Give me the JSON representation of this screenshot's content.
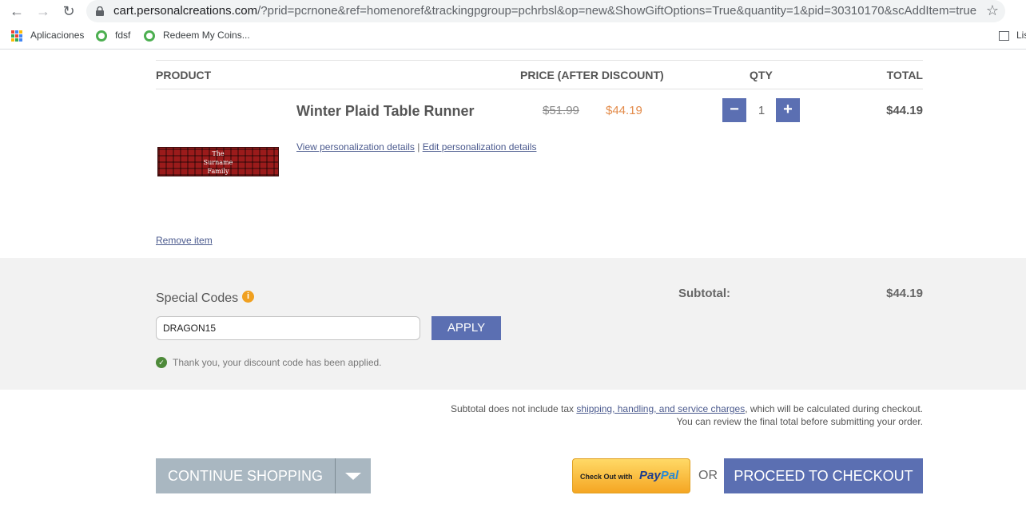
{
  "browser": {
    "url_host": "cart.personalcreations.com",
    "url_path": "/?prid=pcrnone&ref=homenoref&trackingpgroup=pchrbsl&op=new&ShowGiftOptions=True&quantity=1&pid=30310170&scAddItem=true&co...",
    "bookmarks": [
      "Aplicaciones",
      "fdsf",
      "Redeem My Coins..."
    ],
    "list_label": "Lis"
  },
  "cart": {
    "headers": {
      "product": "PRODUCT",
      "price": "PRICE (AFTER DISCOUNT)",
      "qty": "QTY",
      "total": "TOTAL"
    },
    "item": {
      "name": "Winter Plaid Table Runner",
      "price_original": "$51.99",
      "price_discounted": "$44.19",
      "qty": "1",
      "total": "$44.19",
      "thumb_text_line1": "The",
      "thumb_text_line2": "Surname",
      "thumb_text_line3": "Family",
      "view_link": "View personalization details",
      "separator": "|",
      "edit_link": "Edit personalization details",
      "remove_link": "Remove item",
      "minus": "−",
      "plus": "+"
    },
    "codes": {
      "label": "Special Codes",
      "info_glyph": "i",
      "value": "DRAGON15",
      "apply_label": "APPLY",
      "success_glyph": "✓",
      "success_msg": "Thank you, your discount code has been applied."
    },
    "subtotal": {
      "label": "Subtotal:",
      "value": "$44.19"
    },
    "note": {
      "prefix": "Subtotal does not include tax ",
      "link": "shipping, handling, and service charges",
      "suffix": ", which will be calculated during checkout.",
      "line2": "You can review the final total before submitting your order."
    },
    "actions": {
      "continue": "CONTINUE SHOPPING",
      "paypal_small": "Check Out with",
      "paypal_brand_1": "Pay",
      "paypal_brand_2": "Pal",
      "or": "OR",
      "checkout": "PROCEED TO CHECKOUT"
    }
  }
}
